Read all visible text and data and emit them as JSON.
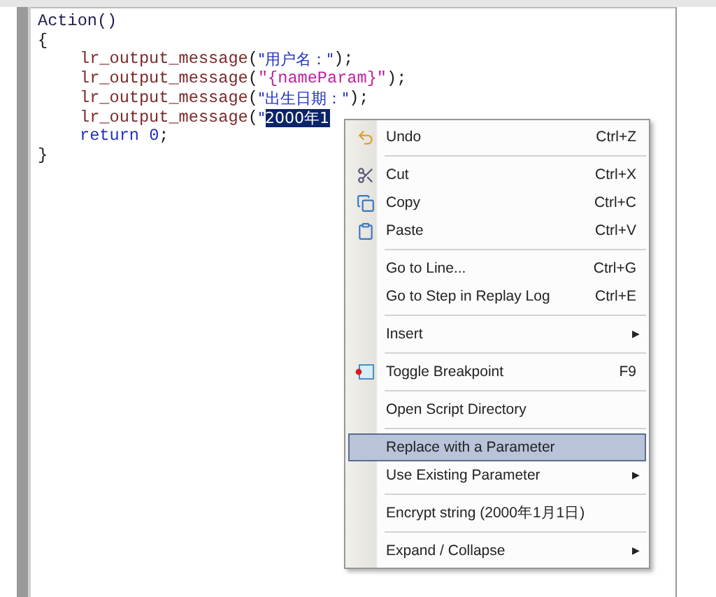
{
  "editor": {
    "lines": [
      {
        "kind": "plain",
        "tokens": [
          {
            "text": "Action()",
            "kind": "ident"
          }
        ]
      },
      {
        "kind": "plain",
        "tokens": [
          {
            "text": "{",
            "kind": "punct"
          }
        ]
      },
      {
        "kind": "indented",
        "tokens": [
          {
            "text": "lr_output_message",
            "kind": "func"
          },
          {
            "text": "(",
            "kind": "punct"
          },
          {
            "text": "\"用户名：\"",
            "kind": "string"
          },
          {
            "text": ");",
            "kind": "punct"
          }
        ]
      },
      {
        "kind": "indented",
        "tokens": [
          {
            "text": "lr_output_message",
            "kind": "func"
          },
          {
            "text": "(",
            "kind": "punct"
          },
          {
            "text": "\"{nameParam}\"",
            "kind": "param"
          },
          {
            "text": ");",
            "kind": "punct"
          }
        ]
      },
      {
        "kind": "indented",
        "tokens": [
          {
            "text": "lr_output_message",
            "kind": "func"
          },
          {
            "text": "(",
            "kind": "punct"
          },
          {
            "text": "\"出生日期：\"",
            "kind": "string"
          },
          {
            "text": ");",
            "kind": "punct"
          }
        ]
      },
      {
        "kind": "indented",
        "tokens": [
          {
            "text": "lr_output_message",
            "kind": "func"
          },
          {
            "text": "(",
            "kind": "punct"
          },
          {
            "text": "\"",
            "kind": "string"
          },
          {
            "text": "2000年1",
            "kind": "selected"
          }
        ]
      },
      {
        "kind": "indented",
        "tokens": [
          {
            "text": "return",
            "kind": "keyword"
          },
          {
            "text": "0",
            "kind": "number"
          },
          {
            "text": ";",
            "kind": "punct"
          }
        ]
      },
      {
        "kind": "plain",
        "tokens": [
          {
            "text": "}",
            "kind": "punct"
          }
        ]
      }
    ]
  },
  "context_menu": {
    "items": [
      {
        "kind": "undo",
        "label": "Undo",
        "shortcut": "Ctrl+Z",
        "selected": false
      },
      {
        "kind": "separator"
      },
      {
        "kind": "cut",
        "label": "Cut",
        "shortcut": "Ctrl+X",
        "selected": false
      },
      {
        "kind": "copy",
        "label": "Copy",
        "shortcut": "Ctrl+C",
        "selected": false
      },
      {
        "kind": "paste",
        "label": "Paste",
        "shortcut": "Ctrl+V",
        "selected": false
      },
      {
        "kind": "separator"
      },
      {
        "kind": "item",
        "label": "Go to Line...",
        "shortcut": "Ctrl+G",
        "selected": false
      },
      {
        "kind": "item",
        "label": "Go to Step in Replay Log",
        "shortcut": "Ctrl+E",
        "selected": false
      },
      {
        "kind": "separator"
      },
      {
        "kind": "item",
        "label": "Insert",
        "arrow": "▶",
        "selected": false
      },
      {
        "kind": "separator"
      },
      {
        "kind": "breakpoint",
        "label": "Toggle Breakpoint",
        "shortcut": "F9",
        "selected": false
      },
      {
        "kind": "separator"
      },
      {
        "kind": "item",
        "label": "Open Script Directory",
        "selected": false
      },
      {
        "kind": "separator"
      },
      {
        "kind": "item",
        "label": "Replace with a Parameter",
        "selected": true
      },
      {
        "kind": "item",
        "label": "Use Existing Parameter",
        "arrow": "▶",
        "selected": false
      },
      {
        "kind": "separator"
      },
      {
        "kind": "item",
        "label": "Encrypt string (2000年1月1日)",
        "selected": false
      },
      {
        "kind": "separator"
      },
      {
        "kind": "item",
        "label": "Expand / Collapse",
        "arrow": "▶",
        "selected": false
      }
    ]
  }
}
